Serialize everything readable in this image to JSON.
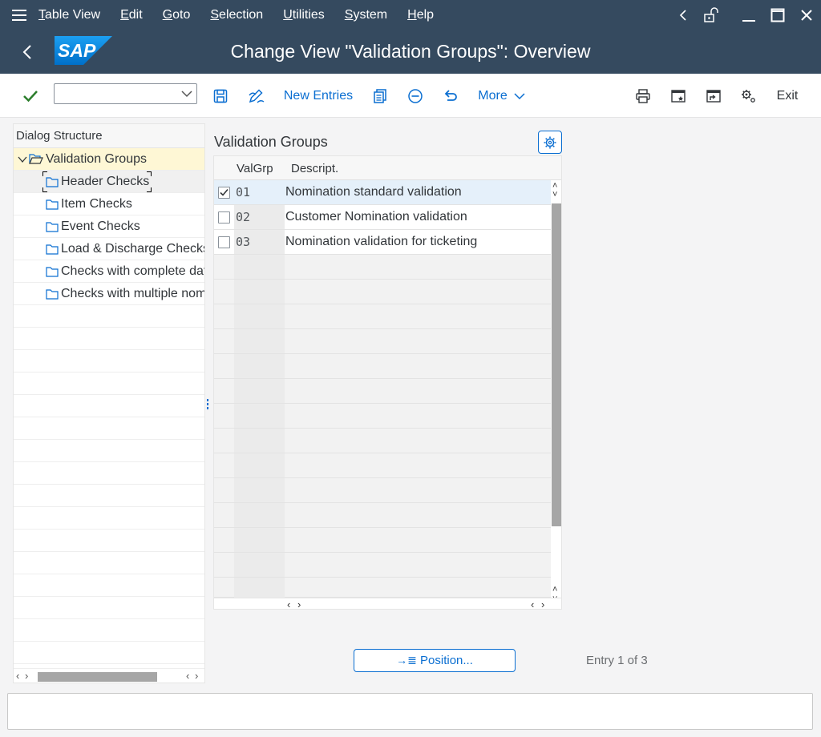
{
  "menubar": {
    "items": [
      "Table View",
      "Edit",
      "Goto",
      "Selection",
      "Utilities",
      "System",
      "Help"
    ],
    "icons": [
      "chevron-left-icon",
      "unlock-icon",
      "minimize-icon",
      "maximize-icon",
      "close-icon"
    ]
  },
  "header": {
    "logo_text": "SAP",
    "title": "Change View \"Validation Groups\": Overview"
  },
  "toolbar": {
    "command_value": "",
    "new_entries_label": "New Entries",
    "more_label": "More",
    "exit_label": "Exit"
  },
  "dialog_structure": {
    "title": "Dialog Structure",
    "root": "Validation Groups",
    "children": [
      "Header Checks",
      "Item Checks",
      "Event Checks",
      "Load & Discharge Checks",
      "Checks with complete data",
      "Checks with multiple nominations"
    ],
    "selected_index": 0
  },
  "table": {
    "title": "Validation Groups",
    "columns": [
      "ValGrp",
      "Descript."
    ],
    "rows": [
      {
        "checked": true,
        "valgrp": "01",
        "descript": "Nomination standard validation"
      },
      {
        "checked": false,
        "valgrp": "02",
        "descript": "Customer Nomination validation"
      },
      {
        "checked": false,
        "valgrp": "03",
        "descript": "Nomination validation for ticketing"
      }
    ]
  },
  "footer": {
    "position_label": "Position...",
    "entry_info": "Entry 1 of 3"
  },
  "colors": {
    "shell": "#354a5f",
    "accent": "#0a6ed1",
    "root_highlight": "#fef7d5",
    "selected_row": "#e5f0fa"
  }
}
